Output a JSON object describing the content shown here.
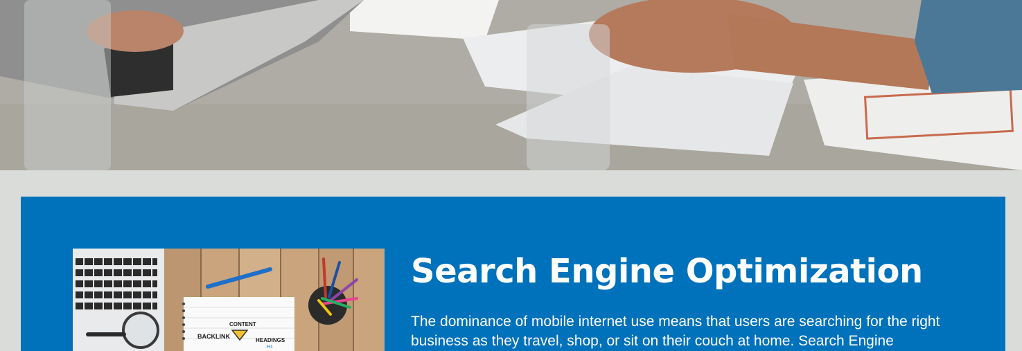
{
  "hero": {
    "image_icon": "meeting-table-photo"
  },
  "seo_section": {
    "image_icon": "seo-notebook-desk-photo",
    "image_labels": {
      "content": "CONTENT",
      "backlink": "BACKLINK",
      "headings": "HEADINGS",
      "h1": "H1"
    },
    "title": "Search Engine Optimization",
    "body": "The dominance of mobile internet use means that users are searching for the right business as they travel, shop, or sit on their couch at home. Search Engine",
    "colors": {
      "panel_background": "#0071bb",
      "page_background": "#d9dcd8",
      "text": "#ffffff"
    }
  }
}
